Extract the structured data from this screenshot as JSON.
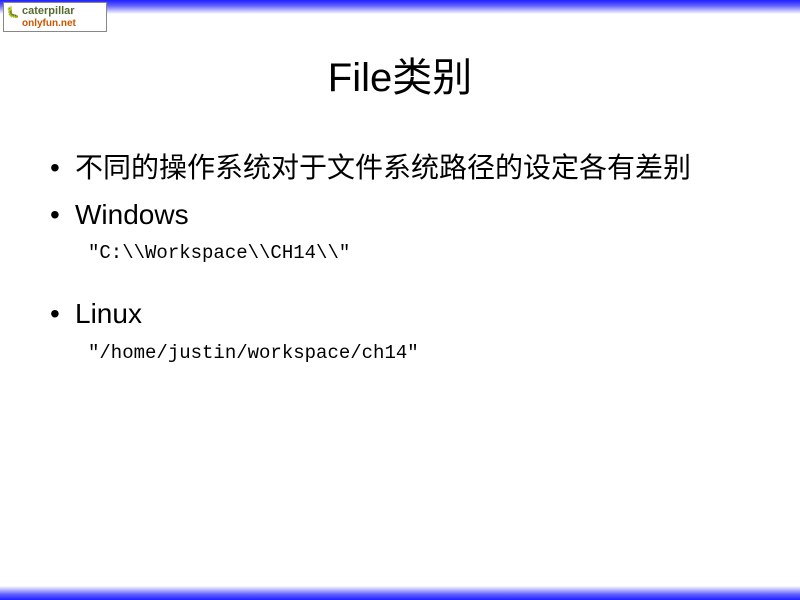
{
  "logo": {
    "line1": "caterpillar",
    "line2": "onlyfun.net"
  },
  "title": "File类别",
  "bullets": {
    "intro": "不同的操作系统对于文件系统路径的设定各有差别",
    "windows_label": "Windows",
    "windows_code": "\"C:\\\\Workspace\\\\CH14\\\\\"",
    "linux_label": "Linux",
    "linux_code": "\"/home/justin/workspace/ch14\""
  }
}
